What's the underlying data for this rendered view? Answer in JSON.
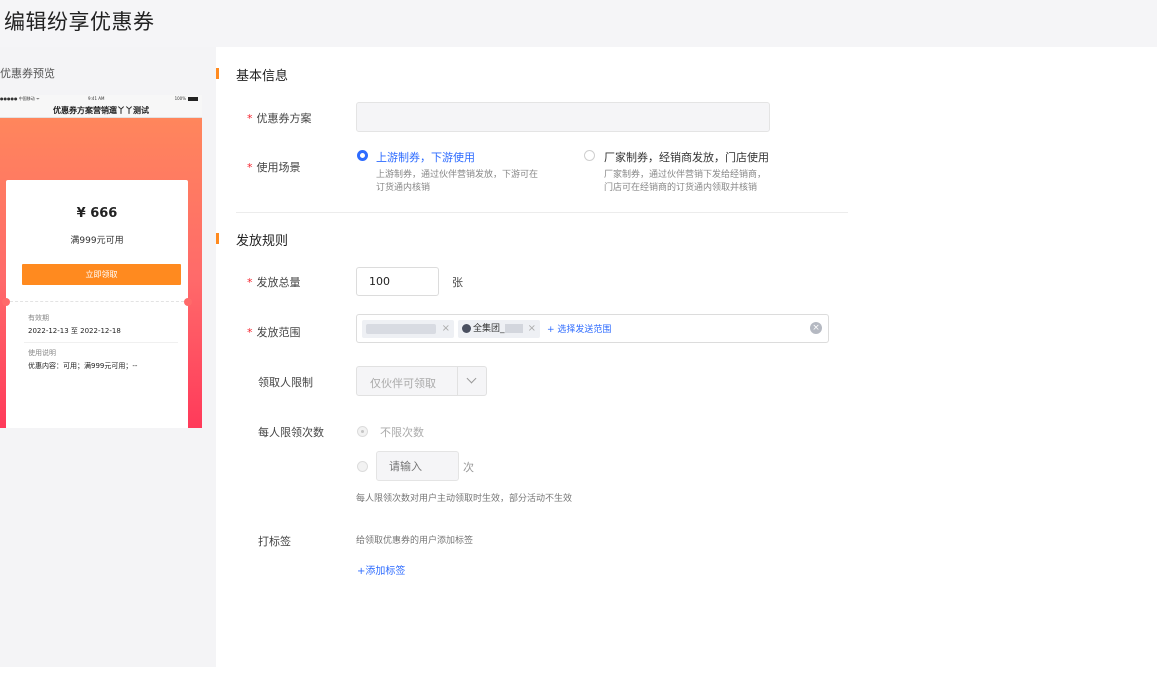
{
  "page": {
    "title": "编辑纷享优惠券"
  },
  "preview": {
    "label": "优惠券预览",
    "status": {
      "left": "●●●●● 中国移动 ᯤ",
      "time": "9:41 AM",
      "right": "100%"
    },
    "nav_title": "优惠券方案营销遛丫丫测试",
    "amount": "¥ 666",
    "condition": "满999元可用",
    "claim_button": "立即领取",
    "valid_label": "有效期",
    "valid_value": "2022-12-13 至 2022-12-18",
    "desc_label": "使用说明",
    "desc_value": "优惠内容：可用；满999元可用；--"
  },
  "colors": {
    "accent": "#ff8a1f",
    "primary": "#2d6bff",
    "required": "#f5222d"
  },
  "basic": {
    "title": "基本信息",
    "plan_label": "优惠券方案",
    "plan_value": "",
    "scene_label": "使用场景",
    "scene_options": [
      {
        "title": "上游制券，下游使用",
        "desc1": "上游制券，通过伙伴营销发放，下游可在",
        "desc2": "订货通内核销",
        "checked": true
      },
      {
        "title": "厂家制券，经销商发放，门店使用",
        "desc1": "厂家制券，通过伙伴营销下发给经销商，",
        "desc2": "门店可在经销商的订货通内领取并核销",
        "checked": false
      }
    ]
  },
  "rules": {
    "title": "发放规则",
    "total_label": "发放总量",
    "total_value": "100",
    "total_unit": "张",
    "scope_label": "发放范围",
    "scope_tags": [
      {
        "label": "",
        "close": "×"
      },
      {
        "label": "全集团_",
        "close": "×"
      }
    ],
    "scope_add": "+ 选择发送范围",
    "scope_clear": "×",
    "receiver_label": "领取人限制",
    "receiver_value": "仅伙伴可领取",
    "per_label": "每人限领次数",
    "per_unlimited": "不限次数",
    "per_placeholder": "请输入",
    "per_unit": "次",
    "per_hint": "每人限领次数对用户主动领取时生效，部分活动不生效",
    "tag_label": "打标签",
    "tag_hint": "给领取优惠券的用户添加标签",
    "tag_add_icon": "+",
    "tag_add": "添加标签"
  }
}
